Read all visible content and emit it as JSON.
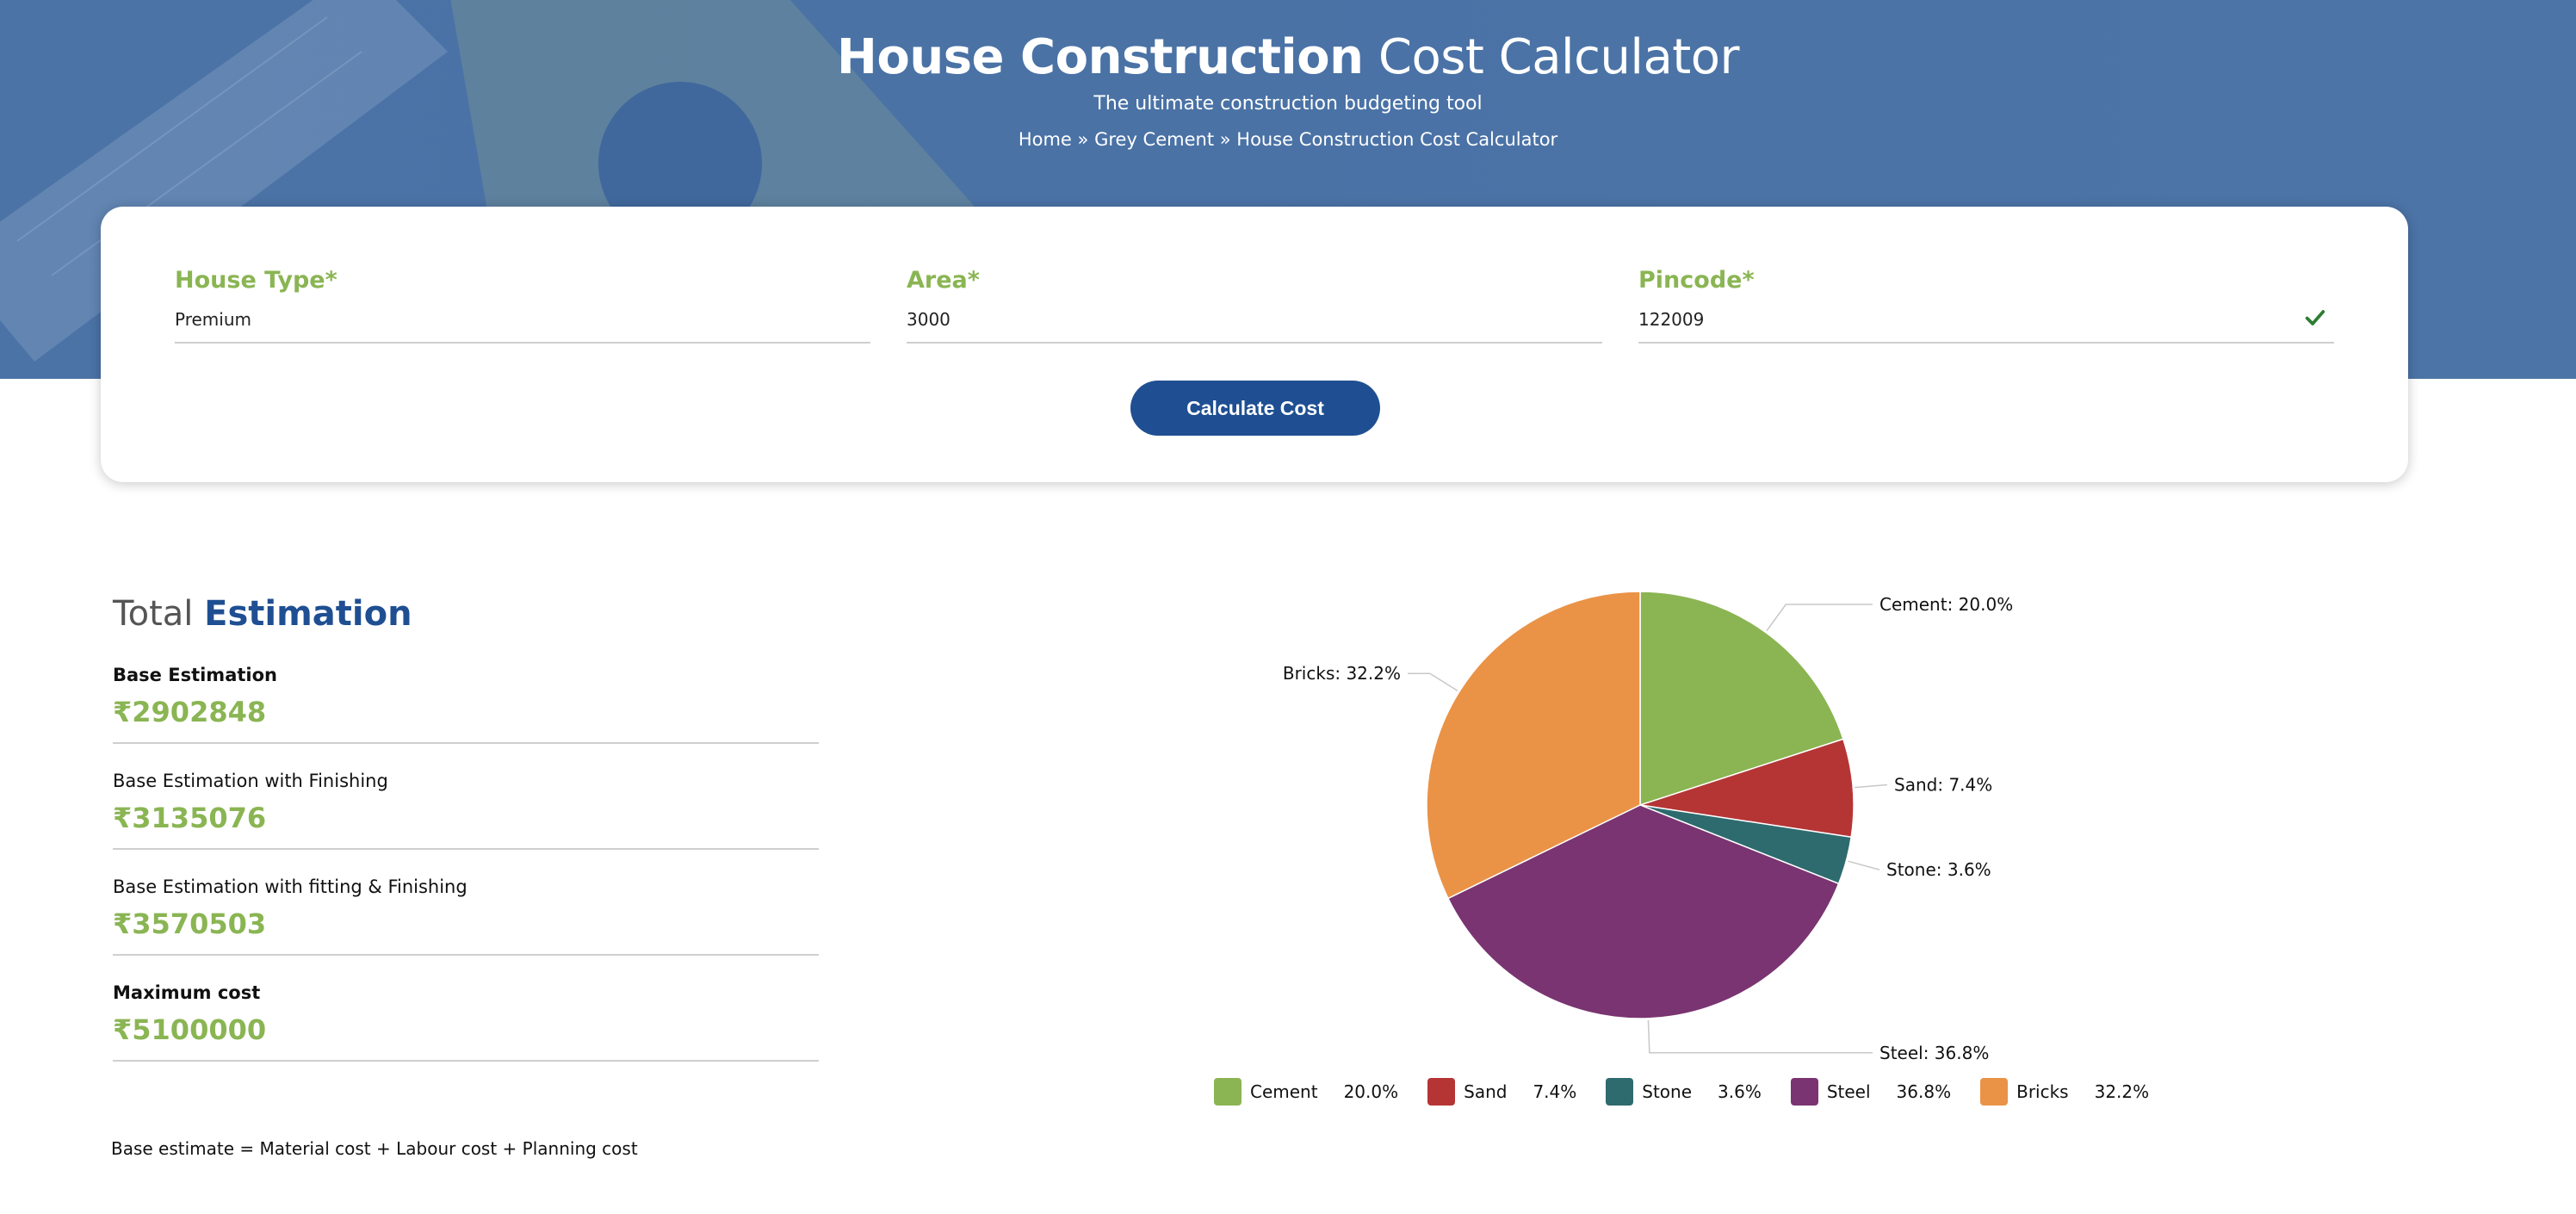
{
  "hero": {
    "title_bold": "House Construction",
    "title_light": "Cost Calculator",
    "subtitle": "The ultimate construction budgeting tool",
    "breadcrumb": [
      "Home",
      "Grey Cement",
      "House Construction Cost Calculator"
    ],
    "breadcrumb_sep": "»"
  },
  "form": {
    "house_type": {
      "label": "House Type*",
      "value": "Premium"
    },
    "area": {
      "label": "Area*",
      "value": "3000"
    },
    "pincode": {
      "label": "Pincode*",
      "value": "122009"
    },
    "button_label": "Calculate Cost"
  },
  "estimation": {
    "title_light": "Total",
    "title_bold": "Estimation",
    "items": [
      {
        "label": "Base Estimation",
        "value": "₹2902848"
      },
      {
        "label": "Base Estimation with Finishing",
        "value": "₹3135076"
      },
      {
        "label": "Base Estimation with fitting & Finishing",
        "value": "₹3570503"
      },
      {
        "label": "Maximum cost",
        "value": "₹5100000"
      }
    ],
    "note": "Base estimate = Material cost + Labour cost + Planning cost"
  },
  "colors": {
    "accent_green": "#8ab553",
    "brand_blue": "#1f4f92",
    "hero_blue": "#4b73a6"
  },
  "chart_data": {
    "type": "pie",
    "categories": [
      "Cement",
      "Sand",
      "Stone",
      "Steel",
      "Bricks"
    ],
    "values": [
      20.0,
      7.4,
      3.6,
      36.8,
      32.2
    ],
    "slice_labels": [
      "Cement: 20.0%",
      "Sand: 7.4%",
      "Stone: 3.6%",
      "Steel: 36.8%",
      "Bricks: 32.2%"
    ],
    "legend_pcts": [
      "20.0%",
      "7.4%",
      "3.6%",
      "36.8%",
      "32.2%"
    ],
    "colors": [
      "#8bb453",
      "#b53535",
      "#2e6b6e",
      "#7a3471",
      "#ea9347"
    ],
    "legend": "bottom"
  }
}
